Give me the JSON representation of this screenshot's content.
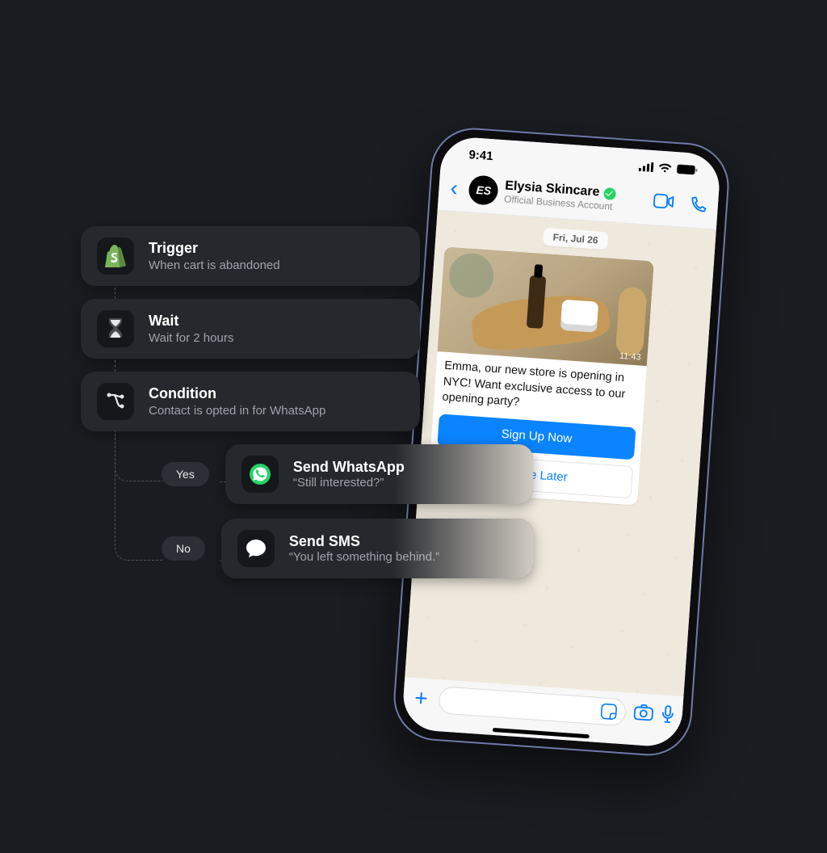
{
  "phone": {
    "status_time": "9:41",
    "chat": {
      "back": "‹",
      "avatar_initials": "ES",
      "title": "Elysia Skincare",
      "subtitle": "Official Business Account",
      "date": "Fri, Jul 26",
      "msg_text": "Emma, our new store is opening in NYC! Want exclusive access to our opening party?",
      "msg_time": "11:43",
      "btn_primary": "Sign Up Now",
      "btn_secondary": "Maybe Later"
    },
    "input": {
      "plus": "+"
    }
  },
  "flow": {
    "trigger": {
      "title": "Trigger",
      "sub": "When cart is abandoned"
    },
    "wait": {
      "title": "Wait",
      "sub": "Wait for 2 hours"
    },
    "cond": {
      "title": "Condition",
      "sub": "Contact is opted in for WhatsApp"
    },
    "yes_label": "Yes",
    "no_label": "No",
    "yes": {
      "title": "Send WhatsApp",
      "sub": "“Still interested?”"
    },
    "no": {
      "title": "Send SMS",
      "sub": "“You left something behind.”"
    }
  }
}
